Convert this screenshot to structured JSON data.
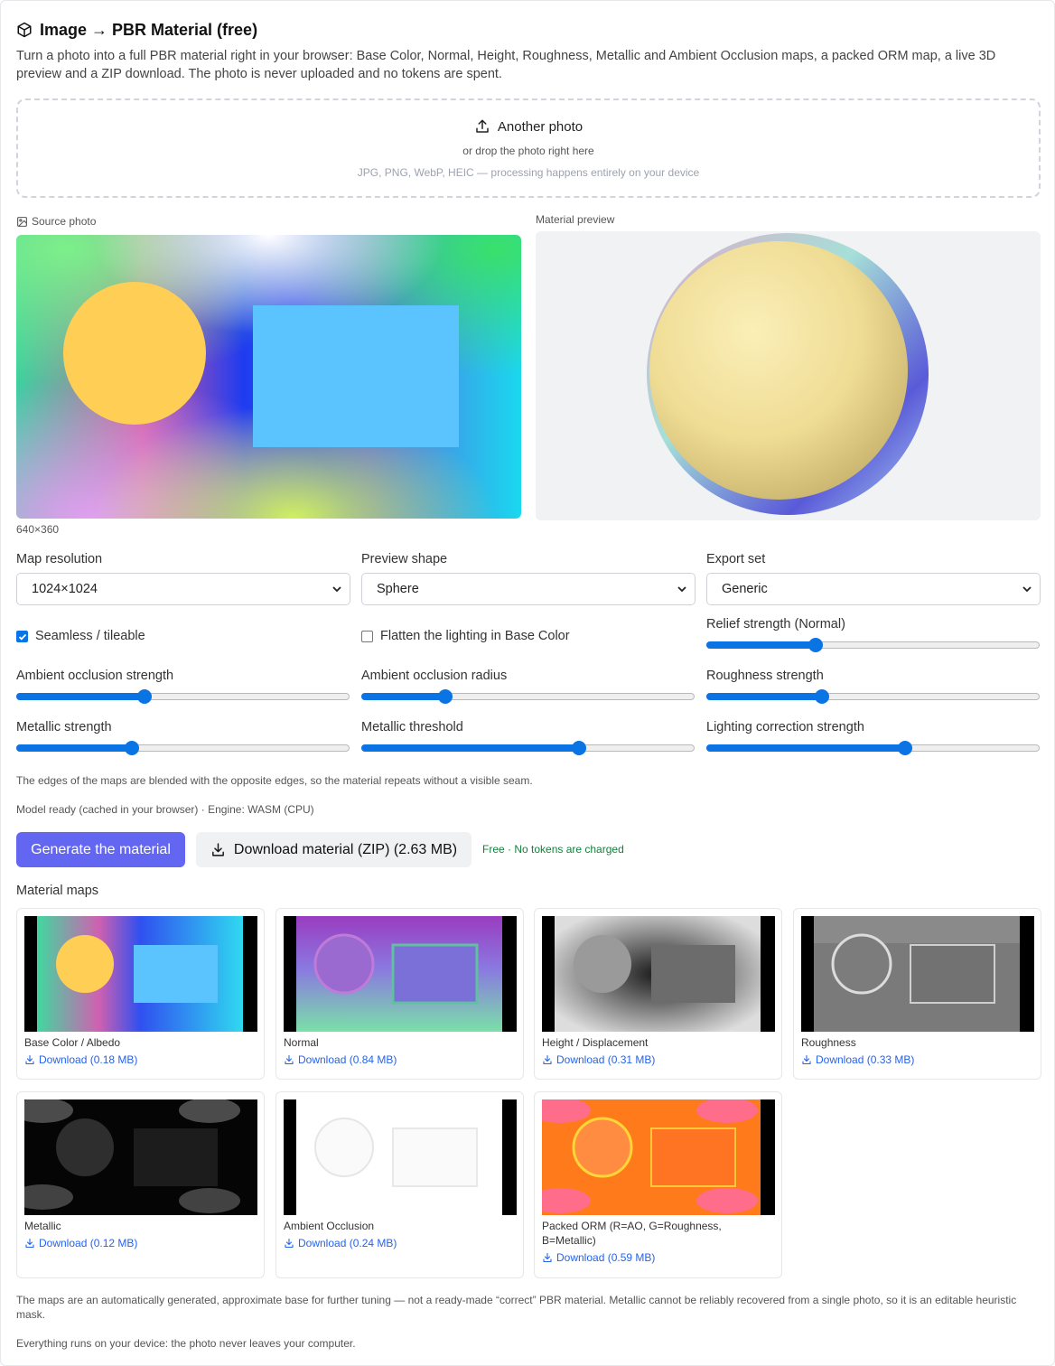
{
  "header": {
    "title": "Image → PBR Material (free)",
    "description": "Turn a photo into a full PBR material right in your browser: Base Color, Normal, Height, Roughness, Metallic and Ambient Occlusion maps, a packed ORM map, a live 3D preview and a ZIP download. The photo is never uploaded and no tokens are spent."
  },
  "dropzone": {
    "button_label": "Another photo",
    "hint": "or drop the photo right here",
    "formats": "JPG, PNG, WebP, HEIC — processing happens entirely on your device"
  },
  "source": {
    "label": "Source photo",
    "dimensions": "640×360"
  },
  "preview": {
    "label": "Material preview"
  },
  "settings": {
    "map_resolution": {
      "label": "Map resolution",
      "value": "1024×1024"
    },
    "preview_shape": {
      "label": "Preview shape",
      "value": "Sphere"
    },
    "export_set": {
      "label": "Export set",
      "value": "Generic"
    },
    "seamless": {
      "label": "Seamless / tileable",
      "checked": true
    },
    "flatten": {
      "label": "Flatten the lighting in Base Color",
      "checked": false
    },
    "sliders": [
      {
        "label": "Relief strength (Normal)",
        "value": 0.32
      },
      {
        "label": "Ambient occlusion strength",
        "value": 0.38
      },
      {
        "label": "Ambient occlusion radius",
        "value": 0.24
      },
      {
        "label": "Roughness strength",
        "value": 0.34
      },
      {
        "label": "Metallic strength",
        "value": 0.34
      },
      {
        "label": "Metallic threshold",
        "value": 0.66
      },
      {
        "label": "Lighting correction strength",
        "value": 0.6
      }
    ],
    "seam_note": "The edges of the maps are blended with the opposite edges, so the material repeats without a visible seam.",
    "model_status": "Model ready (cached in your browser) · Engine: WASM (CPU)"
  },
  "actions": {
    "generate_label": "Generate the material",
    "download_label": "Download material (ZIP) (2.63 MB)",
    "free_note": "Free · No tokens are charged"
  },
  "maps": {
    "title": "Material maps",
    "items": [
      {
        "name": "Base Color / Albedo",
        "download": "Download (0.18 MB)"
      },
      {
        "name": "Normal",
        "download": "Download (0.84 MB)"
      },
      {
        "name": "Height / Displacement",
        "download": "Download (0.31 MB)"
      },
      {
        "name": "Roughness",
        "download": "Download (0.33 MB)"
      },
      {
        "name": "Metallic",
        "download": "Download (0.12 MB)"
      },
      {
        "name": "Ambient Occlusion",
        "download": "Download (0.24 MB)"
      },
      {
        "name": "Packed ORM (R=AO, G=Roughness, B=Metallic)",
        "download": "Download (0.59 MB)"
      }
    ]
  },
  "footer": {
    "disclaimer": "The maps are an automatically generated, approximate base for further tuning — not a ready-made “correct” PBR material. Metallic cannot be reliably recovered from a single photo, so it is an editable heuristic mask.",
    "privacy": "Everything runs on your device: the photo never leaves your computer."
  },
  "colors": {
    "accent": "#6366f1",
    "link": "#2563eb",
    "slider": "#0b74e5",
    "success": "#15803d"
  }
}
